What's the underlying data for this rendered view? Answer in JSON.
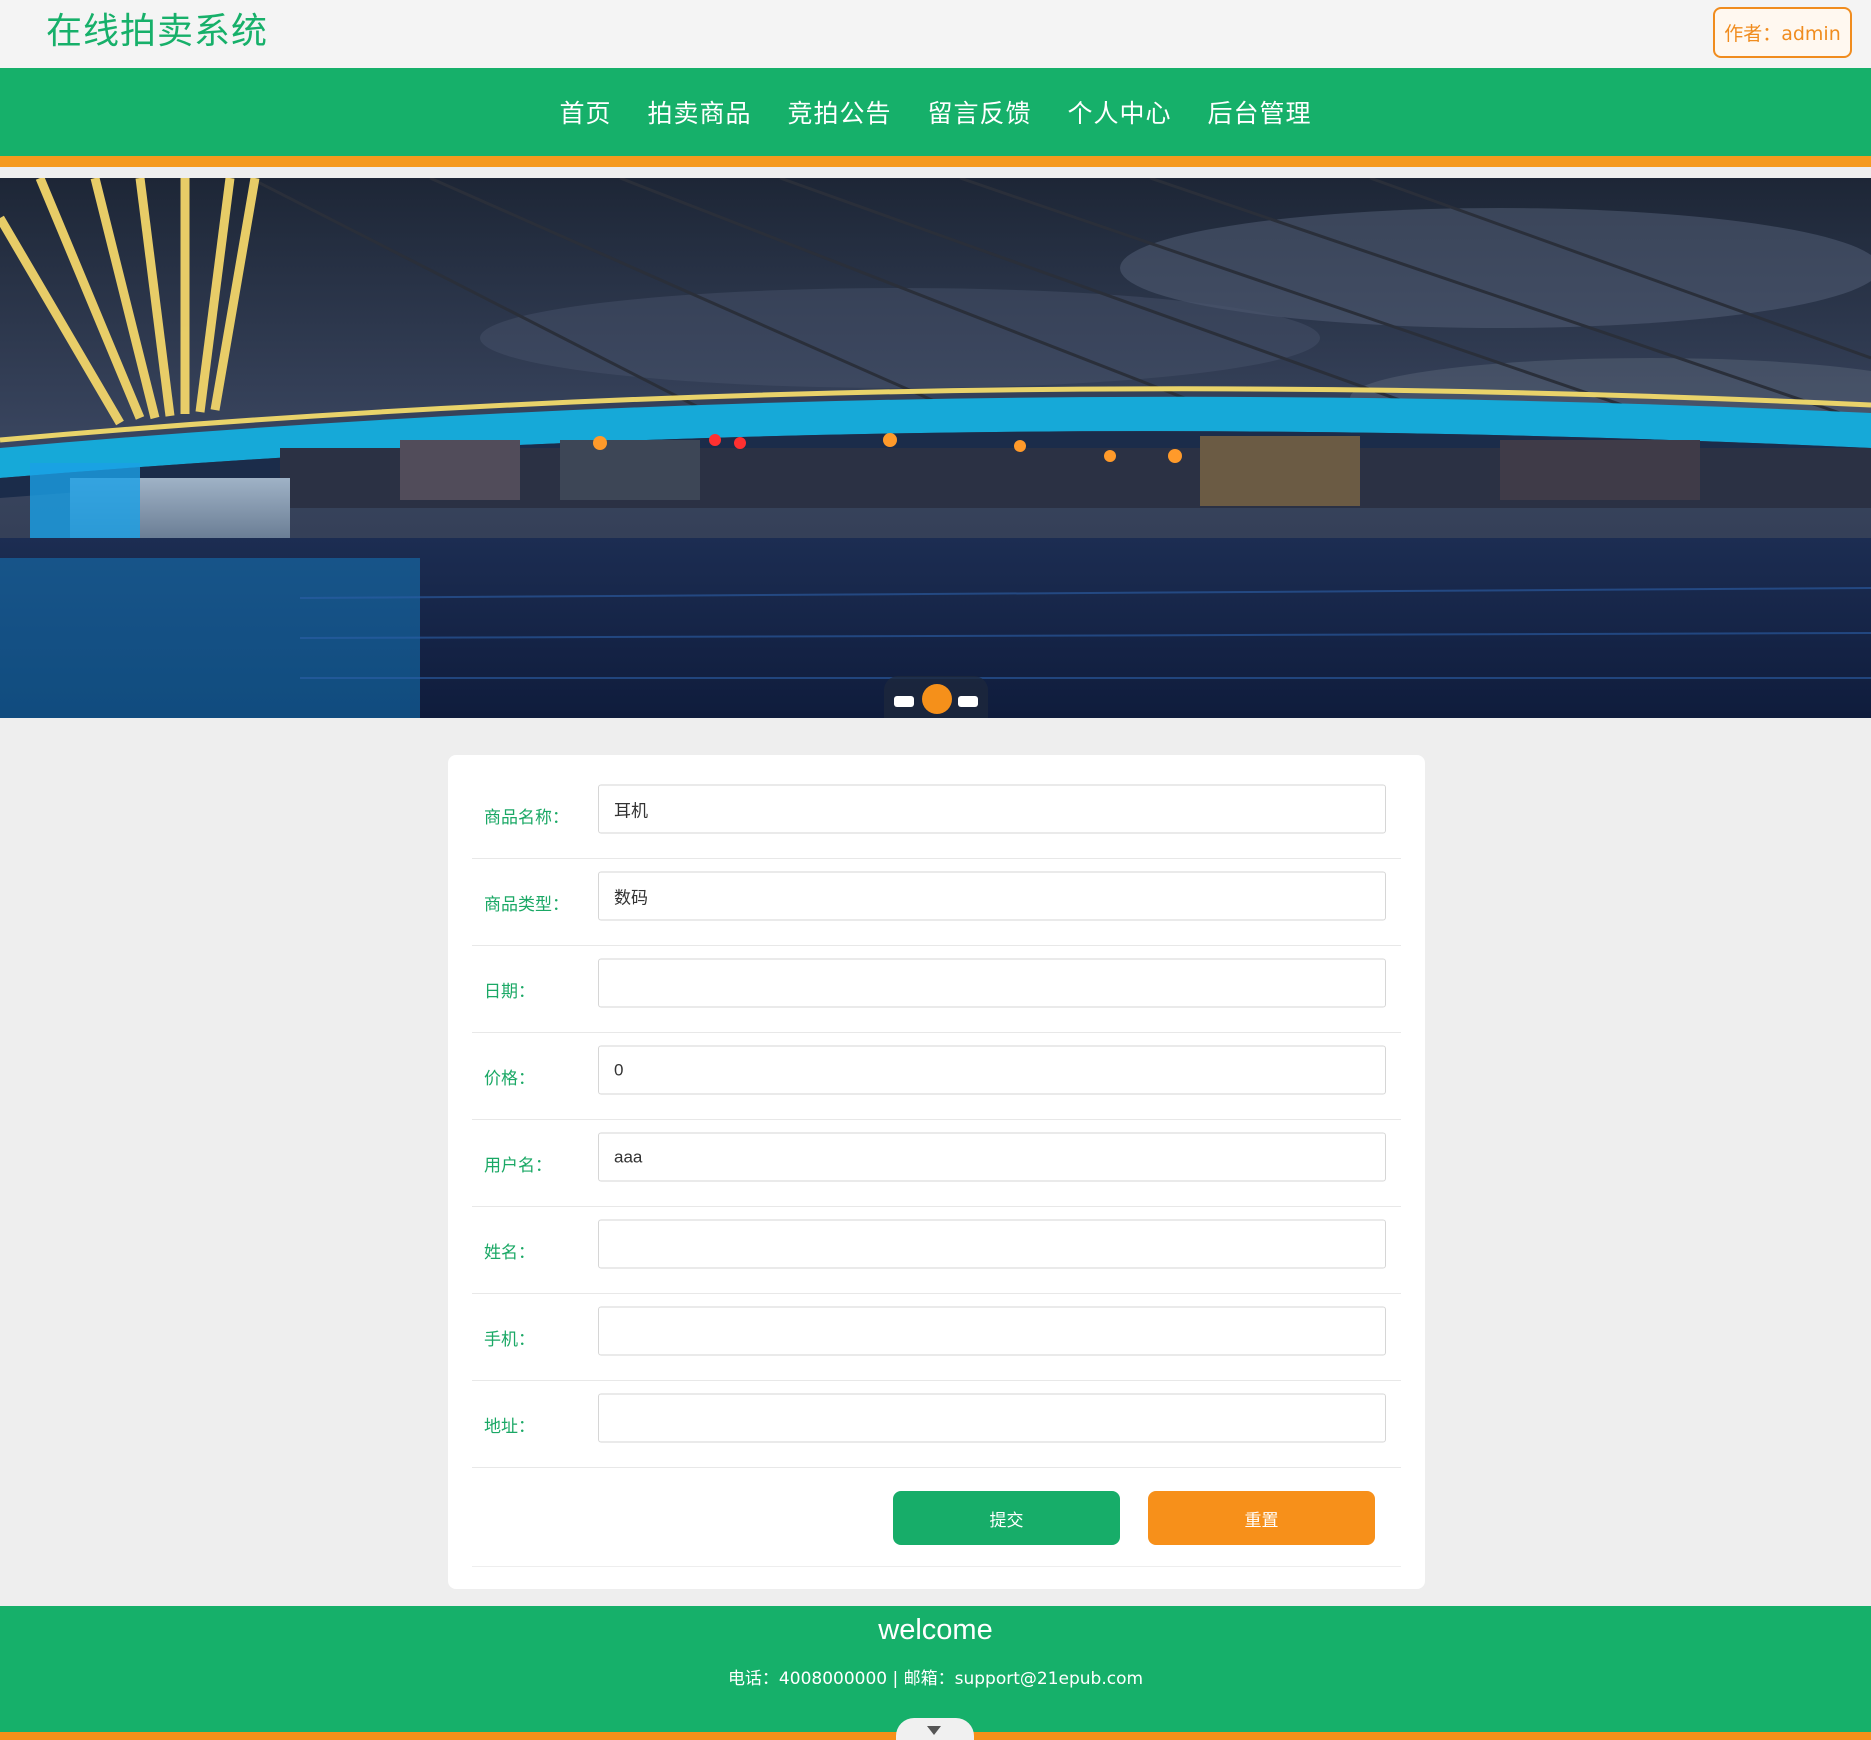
{
  "header": {
    "site_title": "在线拍卖系统",
    "author_label": "作者：admin"
  },
  "nav": {
    "items": [
      "首页",
      "拍卖商品",
      "竞拍公告",
      "留言反馈",
      "个人中心",
      "后台管理"
    ]
  },
  "banner": {
    "slide_count": 3,
    "active_slide": 2
  },
  "form": {
    "fields": [
      {
        "label": "商品名称：",
        "value": ""
      },
      {
        "label": "商品类型：",
        "value": ""
      },
      {
        "label": "日期：",
        "value": ""
      },
      {
        "label": "价格：",
        "value": ""
      },
      {
        "label": "用户名：",
        "value": ""
      },
      {
        "label": "姓名：",
        "value": ""
      },
      {
        "label": "手机：",
        "value": ""
      },
      {
        "label": "地址：",
        "value": ""
      }
    ],
    "values": {
      "name": "耳机",
      "type": "数码",
      "date": "",
      "price": "0",
      "username": "aaa",
      "realname": "",
      "phone": "",
      "address": ""
    },
    "submit_label": "提交",
    "reset_label": "重置"
  },
  "footer": {
    "title": "welcome",
    "contact": "电话：4008000000 | 邮箱：support@21epub.com"
  },
  "colors": {
    "primary_green": "#16b06a",
    "accent_orange": "#f5901a"
  }
}
